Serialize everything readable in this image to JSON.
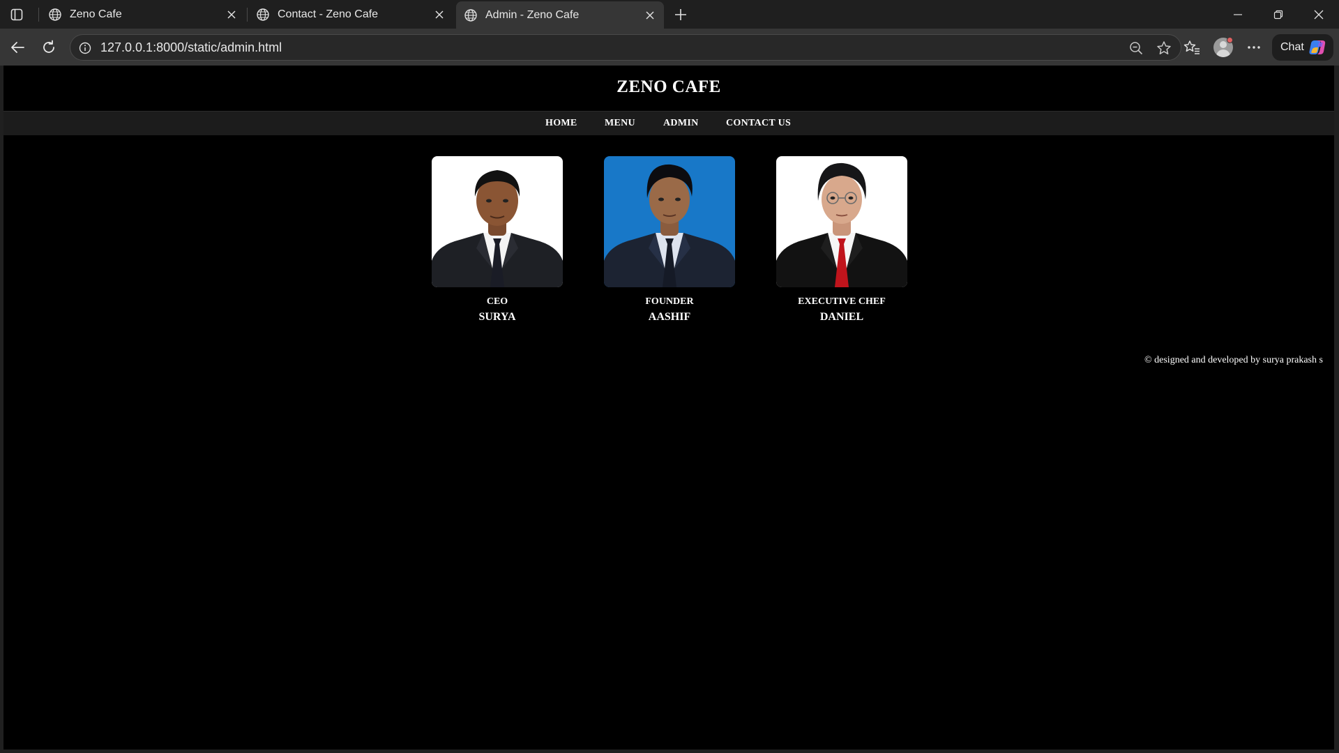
{
  "browser": {
    "tabs": [
      {
        "title": "Zeno Cafe",
        "active": false
      },
      {
        "title": "Contact - Zeno Cafe",
        "active": false
      },
      {
        "title": "Admin - Zeno Cafe",
        "active": true
      }
    ],
    "address_bar": {
      "url": "127.0.0.1:8000/static/admin.html"
    },
    "chat_label": "Chat",
    "icons": [
      "sidebar-toggle-icon",
      "globe-icon",
      "close-icon",
      "plus-icon",
      "minimize-icon",
      "restore-icon",
      "back-icon",
      "reload-icon",
      "info-icon",
      "zoom-out-icon",
      "star-icon",
      "favorites-icon",
      "profile-icon",
      "more-icon",
      "copilot-icon"
    ]
  },
  "site": {
    "title": "ZENO CAFE",
    "nav": [
      "HOME",
      "MENU",
      "ADMIN",
      "CONTACT US"
    ],
    "team": [
      {
        "role": "CEO",
        "name": "SURYA",
        "photo_bg": "#ffffff",
        "suit": "#1e2025",
        "tie": "#1a1c26"
      },
      {
        "role": "FOUNDER",
        "name": "AASHIF",
        "photo_bg": "#1878c8",
        "suit": "#1c2332",
        "tie": "#151a26"
      },
      {
        "role": "EXECUTIVE CHEF",
        "name": "DANIEL",
        "photo_bg": "#ffffff",
        "suit": "#121212",
        "tie": "#c0141c"
      }
    ],
    "footer": "© designed and developed by surya prakash s"
  },
  "colors": {
    "page_background": "#000000",
    "nav_background": "#1c1c1c",
    "text": "#ffffff",
    "browser_frame": "#1f1f1f",
    "toolbar": "#363636"
  }
}
